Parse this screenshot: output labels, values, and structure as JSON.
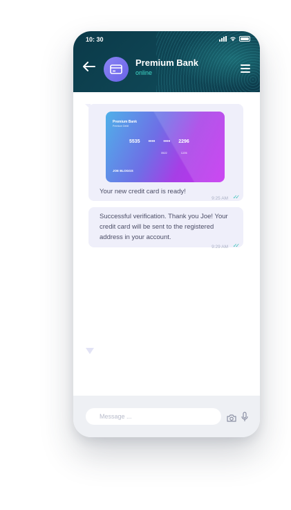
{
  "status": {
    "time": "10: 30"
  },
  "header": {
    "title": "Premium Bank",
    "status": "online"
  },
  "card": {
    "title": "Premium Bank",
    "subtitle": "Premium Debit",
    "number_groups": [
      "5535",
      "••••",
      "••••",
      "2296"
    ],
    "dates": [
      "05/22",
      "12/26"
    ],
    "holder": "JOE BLOGGS"
  },
  "messages": [
    {
      "text": "Your new credit card is ready!",
      "time": "9:25 AM",
      "check": "✓✓"
    },
    {
      "text": "Successful verification. Thank you Joe! Your credit card will be sent to the registered address in your account.",
      "time": "9:29 AM",
      "check": "✓✓"
    }
  ],
  "composer": {
    "placeholder": "Message ..."
  },
  "colors": {
    "header": "#0f4756",
    "accent": "#3fd7c7",
    "bubble": "#efeffa"
  }
}
